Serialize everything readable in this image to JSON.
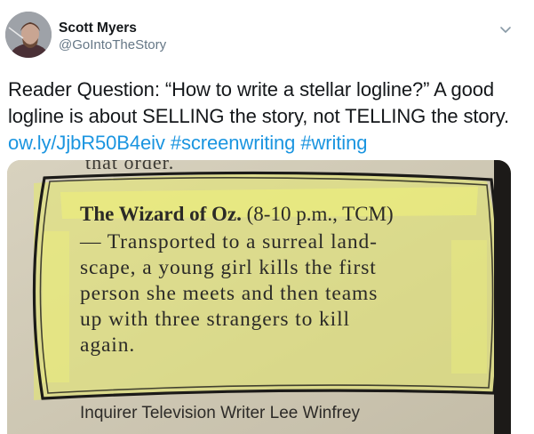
{
  "author": {
    "name": "Scott Myers",
    "handle": "@GoIntoTheStory"
  },
  "tweet": {
    "line1": "Reader Question: “How to write a stellar logline?” A good",
    "line2": "logline is about SELLING the story, not TELLING the story.",
    "link_url": "ow.ly/JjbR50B4eiv",
    "hashtag1": "#screenwriting",
    "hashtag2": "#writing"
  },
  "clipping": {
    "top_fragment": "that order.",
    "title": "The Wizard of Oz.",
    "title_rest": " (8-10 p.m., TCM)",
    "lines": [
      "— Transported to a surreal land-",
      "scape, a young girl kills the first",
      "person she meets and then teams",
      "up with three strangers to kill",
      "again."
    ],
    "credit": "Inquirer Television Writer Lee Winfrey"
  },
  "icons": {
    "menu": "chevron-down-icon",
    "avatar": "profile-photo"
  },
  "colors": {
    "link": "#1b95e0",
    "text": "#14171a",
    "secondary": "#657786",
    "highlight": "#e8ec6a"
  }
}
